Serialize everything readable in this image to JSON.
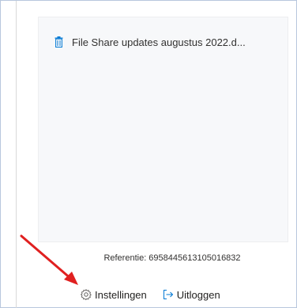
{
  "attachment": {
    "file_name": "File Share updates augustus 2022.d...",
    "icon": "trash-icon"
  },
  "reference": "Referentie: 6958445613105016832",
  "footer": {
    "settings_label": "Instellingen",
    "settings_icon": "gear-icon",
    "logout_label": "Uitloggen",
    "logout_icon": "sign-out-icon"
  },
  "colors": {
    "accent": "#0078d4",
    "annotation_arrow": "#e02020",
    "panel_bg": "#f7f8fa",
    "text": "#323130"
  }
}
